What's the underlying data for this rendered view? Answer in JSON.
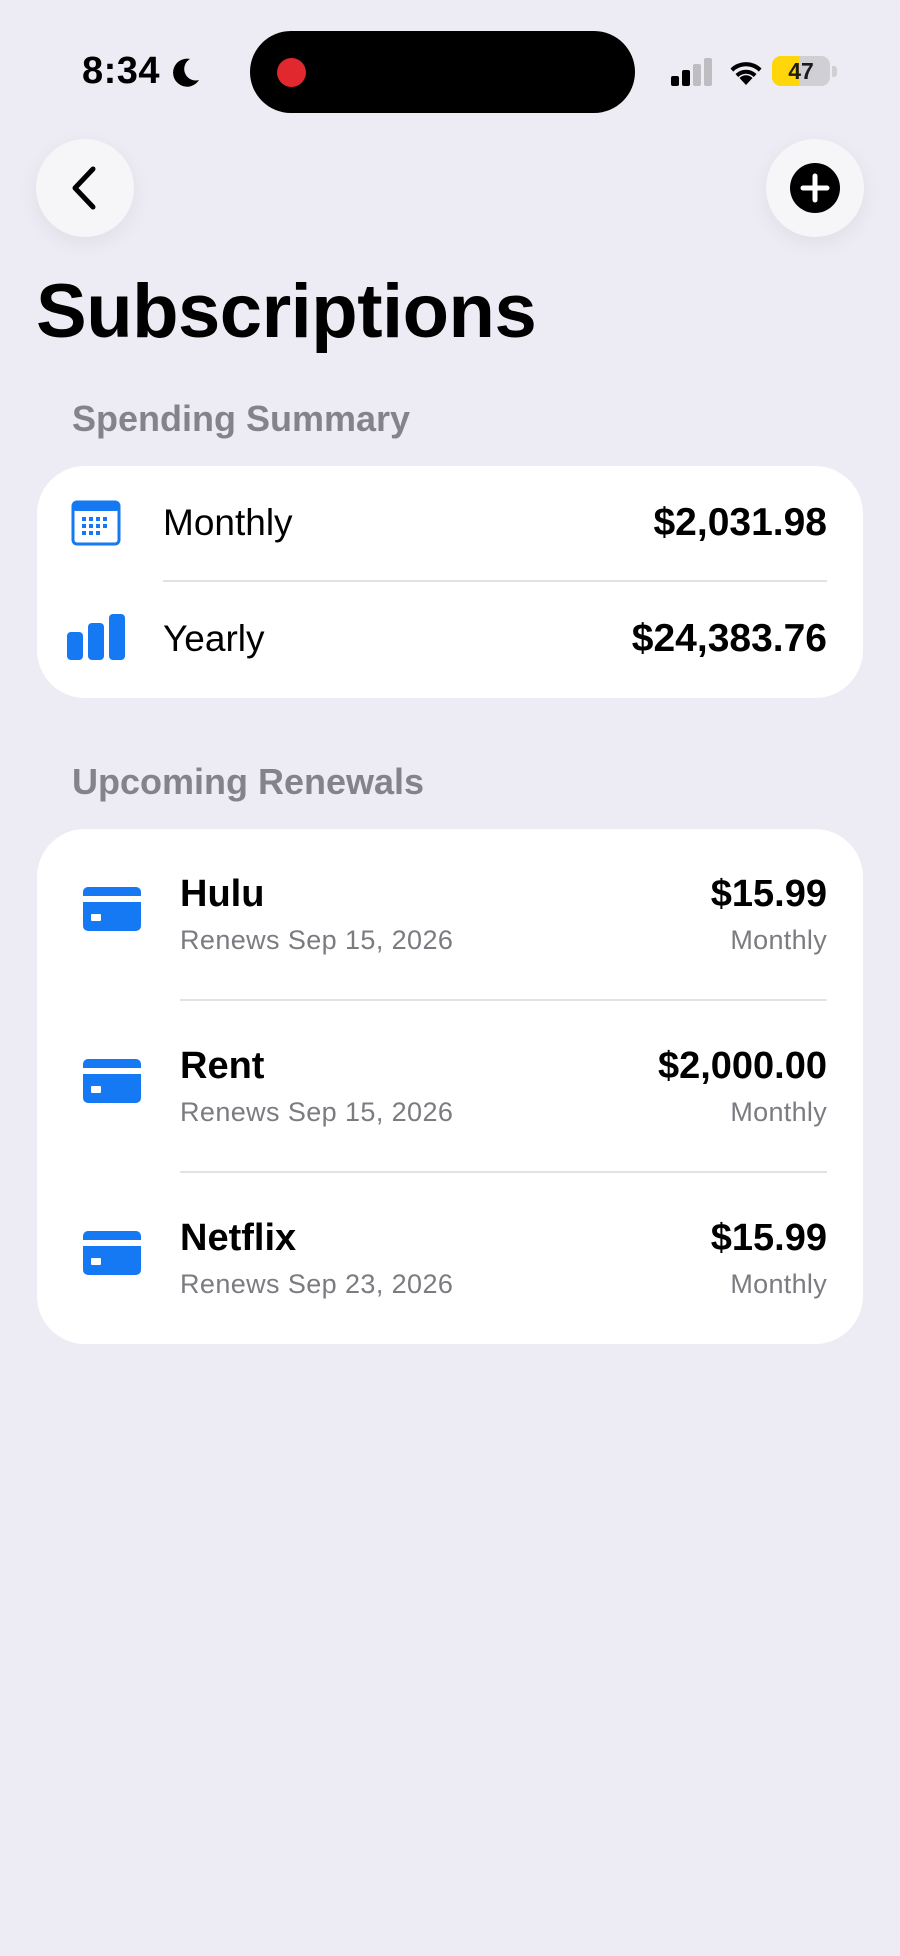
{
  "status_bar": {
    "time": "8:34",
    "battery_level": "47",
    "battery_percent": 47,
    "icons": [
      "moon-icon",
      "recording-indicator",
      "cellular-signal-icon",
      "wifi-icon",
      "battery-icon"
    ]
  },
  "nav": {
    "back_icon": "chevron-left-icon",
    "add_icon": "plus-circle-icon"
  },
  "page": {
    "title": "Subscriptions"
  },
  "summary": {
    "header": "Spending Summary",
    "rows": [
      {
        "label": "Monthly",
        "value": "$2,031.98",
        "icon": "calendar-icon"
      },
      {
        "label": "Yearly",
        "value": "$24,383.76",
        "icon": "bar-chart-icon"
      }
    ]
  },
  "renewals": {
    "header": "Upcoming Renewals",
    "items": [
      {
        "name": "Hulu",
        "date": "Renews Sep 15, 2026",
        "price": "$15.99",
        "frequency": "Monthly",
        "icon": "credit-card-icon"
      },
      {
        "name": "Rent",
        "date": "Renews Sep 15, 2026",
        "price": "$2,000.00",
        "frequency": "Monthly",
        "icon": "credit-card-icon"
      },
      {
        "name": "Netflix",
        "date": "Renews Sep 23, 2026",
        "price": "$15.99",
        "frequency": "Monthly",
        "icon": "credit-card-icon"
      }
    ]
  },
  "colors": {
    "background": "#EDECF4",
    "card": "#FFFFFF",
    "accent": "#1479F2",
    "secondary_text": "#7B7B81",
    "battery": "#FFD60A",
    "recording": "#E0282E"
  }
}
